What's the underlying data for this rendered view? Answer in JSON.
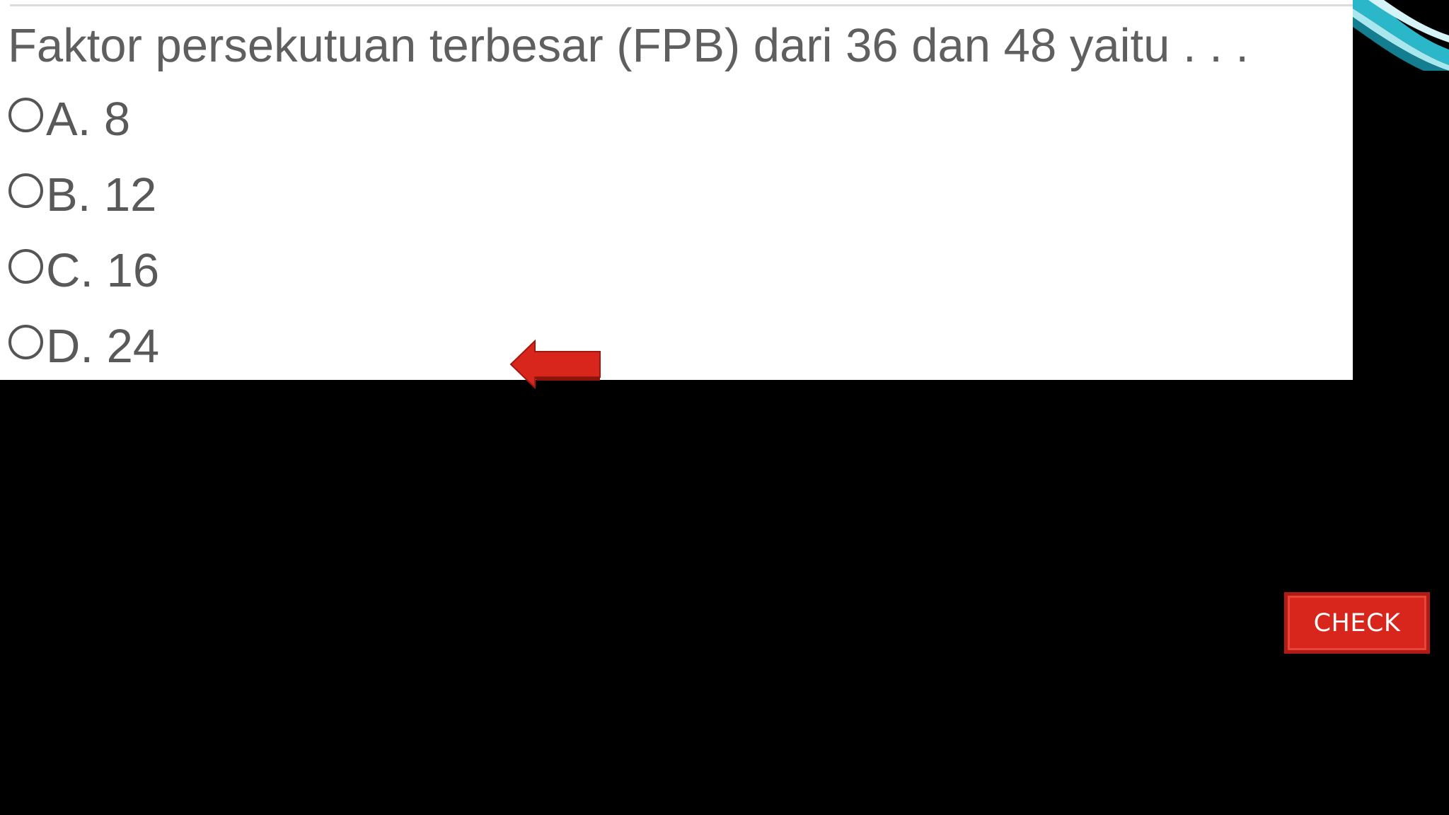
{
  "question": {
    "text": "Faktor persekutuan terbesar (FPB) dari 36 dan 48 yaitu . . ."
  },
  "options": [
    {
      "label": "A. 8"
    },
    {
      "label": "B. 12"
    },
    {
      "label": "C. 16"
    },
    {
      "label": "D. 24"
    }
  ],
  "check_button": {
    "label": "CHECK"
  },
  "icons": {
    "arrow": "left-arrow-icon",
    "radio": "radio-unselected-icon",
    "decoration": "corner-swoosh"
  },
  "colors": {
    "background": "#000000",
    "panel": "#ffffff",
    "text": "#5f5f5f",
    "accent_red": "#d9261c",
    "swoosh_teal": "#2ab7c9"
  }
}
